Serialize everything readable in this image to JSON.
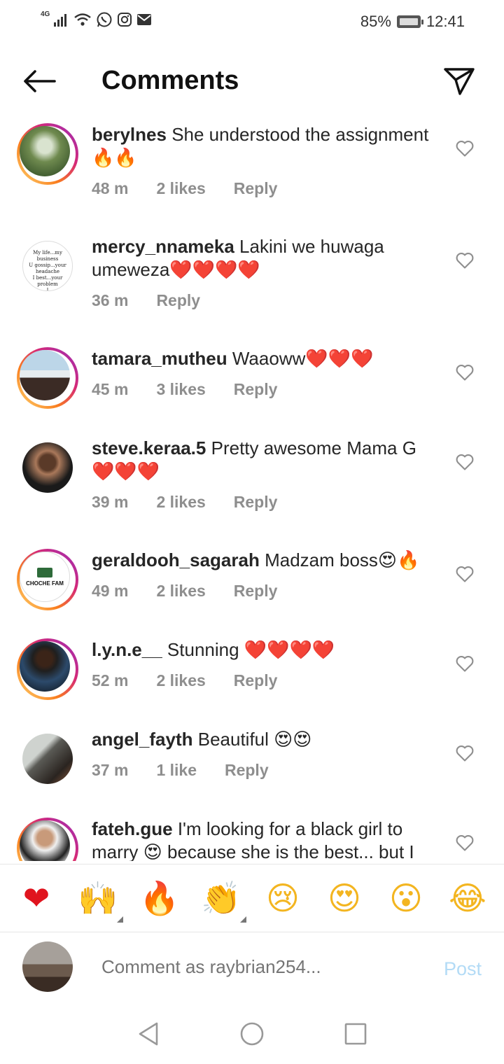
{
  "status_bar": {
    "network_type": "4G",
    "battery": "85%",
    "time": "12:41",
    "icons": [
      "signal-icon",
      "wifi-icon",
      "whatsapp-icon",
      "instagram-icon",
      "mail-icon",
      "battery-icon"
    ]
  },
  "header": {
    "title": "Comments",
    "back_icon": "arrow-left-icon",
    "share_icon": "send-icon"
  },
  "comments": [
    {
      "username": "berylnes",
      "text": "She understood the assignment 🔥🔥",
      "time": "48 m",
      "likes": "2 likes",
      "reply": "Reply",
      "story_ring": true
    },
    {
      "username": "mercy_nnameka",
      "text": "Lakini we huwaga umeweza❤️❤️❤️❤️",
      "time": "36 m",
      "likes": "",
      "reply": "Reply",
      "story_ring": false
    },
    {
      "username": "tamara_mutheu",
      "text": "Waaoww❤️❤️❤️",
      "time": "45 m",
      "likes": "3 likes",
      "reply": "Reply",
      "story_ring": true
    },
    {
      "username": "steve.keraa.5",
      "text": "Pretty awesome Mama G ❤️❤️❤️",
      "time": "39 m",
      "likes": "2 likes",
      "reply": "Reply",
      "story_ring": false
    },
    {
      "username": "geraldooh_sagarah",
      "text": "Madzam boss😍🔥",
      "time": "49 m",
      "likes": "2 likes",
      "reply": "Reply",
      "story_ring": true
    },
    {
      "username": "l.y.n.e__",
      "text": "Stunning ❤️❤️❤️❤️",
      "time": "52 m",
      "likes": "2 likes",
      "reply": "Reply",
      "story_ring": true
    },
    {
      "username": "angel_fayth",
      "text": "Beautiful 😍😍",
      "time": "37 m",
      "likes": "1 like",
      "reply": "Reply",
      "story_ring": false
    },
    {
      "username": "fateh.gue",
      "text": "I'm looking for a black girl to marry 😍 because she is the best... but I",
      "time": "",
      "likes": "",
      "reply": "",
      "story_ring": true
    }
  ],
  "emoji_bar": [
    "❤",
    "🙌",
    "🔥",
    "👏",
    "😢",
    "😍",
    "😮",
    "😂"
  ],
  "composer": {
    "placeholder": "Comment as raybrian254...",
    "post_label": "Post"
  },
  "colors": {
    "text": "#262626",
    "meta": "#8e8e8e",
    "post_disabled": "#b3dbf6",
    "heart_red": "#e0141e"
  }
}
